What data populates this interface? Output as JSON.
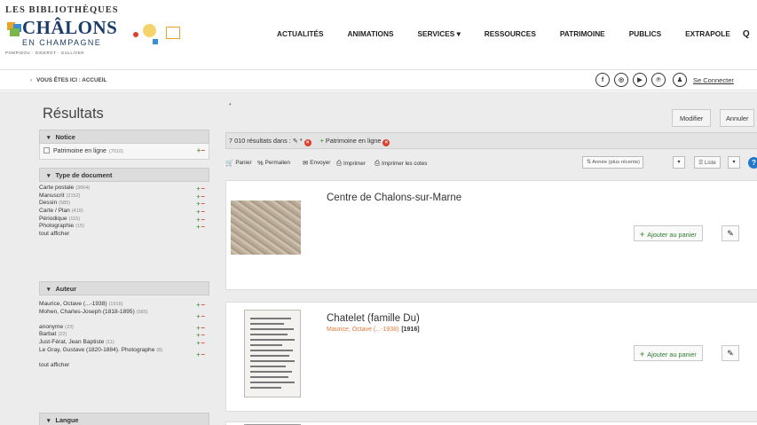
{
  "logo": {
    "top": "LES BIBLIOTHÈQUES",
    "main": "CHÂLONS",
    "sub": "EN CHAMPAGNE",
    "tagline": "POMPIDOU · DIDEROT · GULLIVER"
  },
  "nav": {
    "items": [
      "ACTUALITÉS",
      "ANIMATIONS",
      "SERVICES ▾",
      "RESSOURCES",
      "PATRIMOINE",
      "PUBLICS",
      "EXTRAPOLE"
    ],
    "search_icon": "search-icon"
  },
  "breadcrumb": {
    "marker": "›",
    "text": "VOUS ÊTES ICI : ACCUEIL"
  },
  "social": {
    "icons": [
      "facebook-icon",
      "instagram-icon",
      "youtube-icon",
      "pinterest-icon"
    ],
    "glyphs": [
      "f",
      "◎",
      "▶",
      "℗"
    ]
  },
  "login": {
    "icon": "user-icon",
    "glyph": "♟",
    "label": "Se Connecter"
  },
  "sidebar": {
    "title": "Résultats",
    "notice": {
      "heading": "Notice",
      "selected": "Patrimoine en ligne",
      "selected_count": "(7010)"
    },
    "type_document": {
      "heading": "Type de document",
      "items": [
        {
          "label": "Carte postale",
          "count": "(3664)"
        },
        {
          "label": "Manuscrit",
          "count": "(2152)"
        },
        {
          "label": "Dessin",
          "count": "(585)"
        },
        {
          "label": "Carte / Plan",
          "count": "(419)"
        },
        {
          "label": "Périodique",
          "count": "(115)"
        },
        {
          "label": "Photographie",
          "count": "(15)"
        }
      ],
      "show_all": "tout afficher"
    },
    "auteur": {
      "heading": "Auteur",
      "items": [
        {
          "label": "Maurice, Octave (...-1938)",
          "count": "(1916)"
        },
        {
          "label": "Mohen, Charles-Joseph (1818-1895)",
          "count": "(585)"
        },
        {
          "label": "anonyme",
          "count": "(23)"
        },
        {
          "label": "Barbat",
          "count": "(22)"
        },
        {
          "label": "Just-Férat, Jean Baptiste",
          "count": "(11)"
        },
        {
          "label": "Le Gray, Gustave (1820-1884). Photographe",
          "count": "(8)"
        }
      ],
      "show_all": "tout afficher"
    },
    "langue": {
      "heading": "Langue"
    }
  },
  "content": {
    "star": "*",
    "modify_button": "Modifier",
    "cancel_button": "Annuler",
    "result_text": "7 010 résultats dans :",
    "criteria_star": "*",
    "filter_label": "Patrimoine en ligne",
    "toolbar": {
      "cart": "Panier",
      "permalink": "Permalien",
      "send": "Envoyer",
      "print": "Imprimer",
      "print_codes": "Imprimer les cotes"
    },
    "sort": {
      "selected": "Année (plus récente)",
      "arrow": "▾"
    },
    "view": {
      "selected": "Liste",
      "arrow": "▾"
    },
    "help": "?",
    "results": [
      {
        "title": "Centre de Chalons-sur-Marne",
        "author": "",
        "year": "",
        "add_label": "Ajouter au panier"
      },
      {
        "title": "Chatelet (famille Du)",
        "author": "Maurice, Octave (...-1938)",
        "year": "[1916]",
        "add_label": "Ajouter au panier"
      }
    ]
  },
  "colors": {
    "brand": "#1c3d6a",
    "add": "#5aa04b",
    "remove": "#d9402f",
    "author": "#e07b39",
    "panel": "#ececec"
  }
}
